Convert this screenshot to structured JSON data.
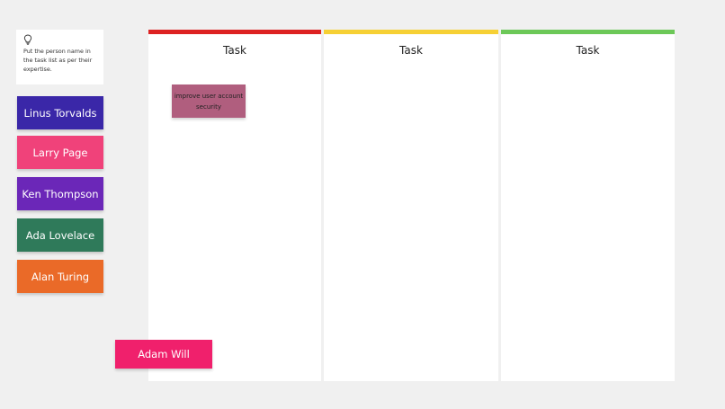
{
  "instruction": {
    "icon": "lightbulb-icon",
    "text": "Put the person name in the task list as per their expertise."
  },
  "people": [
    {
      "name": "Linus Torvalds",
      "color": "#3a27a8"
    },
    {
      "name": "Larry Page",
      "color": "#f0427a"
    },
    {
      "name": "Ken Thompson",
      "color": "#6b27b8"
    },
    {
      "name": "Ada Lovelace",
      "color": "#2f7a5a"
    },
    {
      "name": "Alan Turing",
      "color": "#ea6a28"
    },
    {
      "name": "Adam Will",
      "color": "#f0206c"
    }
  ],
  "columns": [
    {
      "title": "Task",
      "accent": "#dd2222"
    },
    {
      "title": "Task",
      "accent": "#f6d034"
    },
    {
      "title": "Task",
      "accent": "#6cc858"
    }
  ],
  "task_note": {
    "text": "improve user account security",
    "color": "#b05e7e"
  }
}
